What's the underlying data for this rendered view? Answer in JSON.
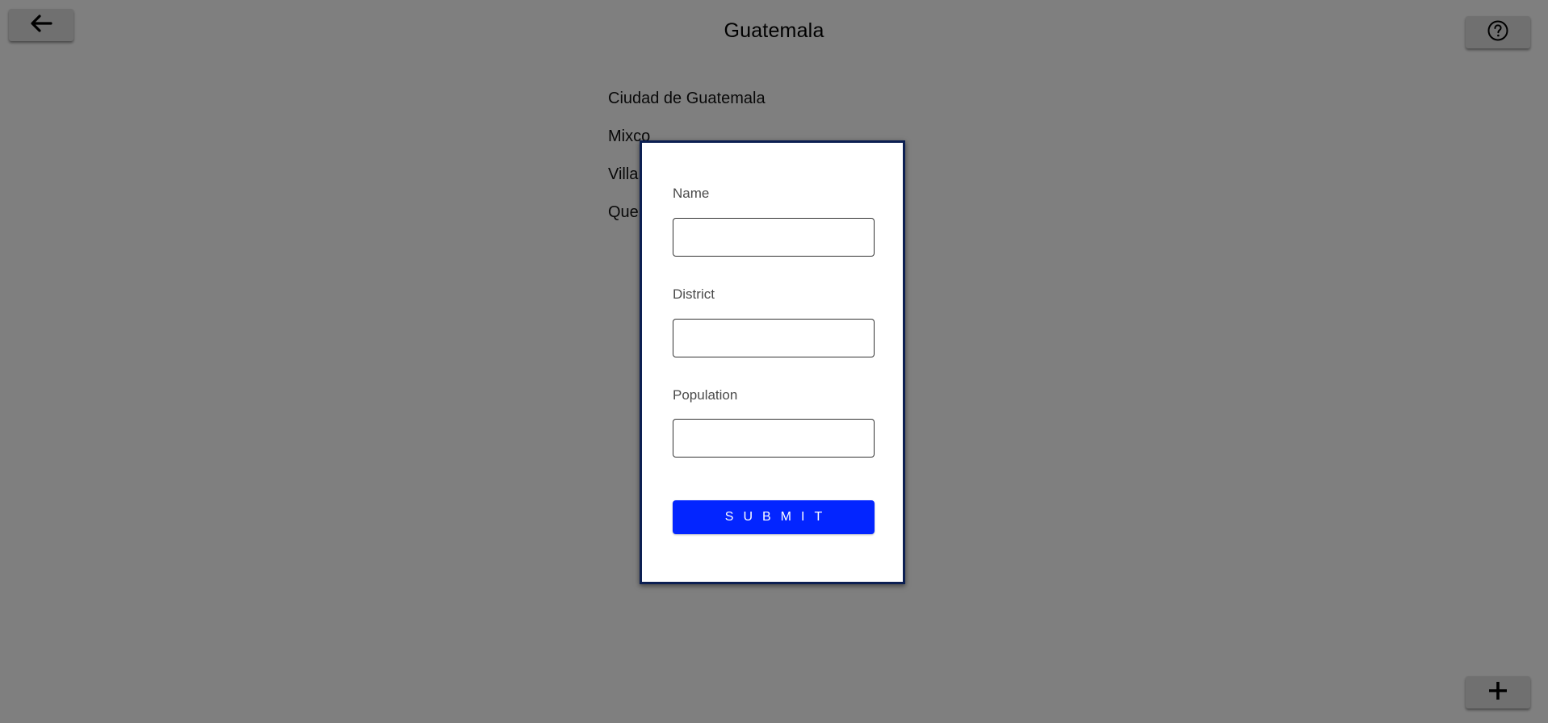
{
  "header": {
    "title": "Guatemala",
    "back_icon": "arrow-left-icon",
    "help_icon": "question-circle-icon"
  },
  "cities": [
    "Ciudad de Guatemala",
    "Mixco",
    "Villa",
    "Que"
  ],
  "form": {
    "name_label": "Name",
    "name_value": "",
    "district_label": "District",
    "district_value": "",
    "population_label": "Population",
    "population_value": "",
    "submit_label": "SUBMIT"
  },
  "fab": {
    "add_icon": "plus-icon"
  },
  "colors": {
    "submit_button": "#0325ff",
    "modal_border": "#0c1f52",
    "overlay": "rgba(0,0,0,0.5)"
  }
}
